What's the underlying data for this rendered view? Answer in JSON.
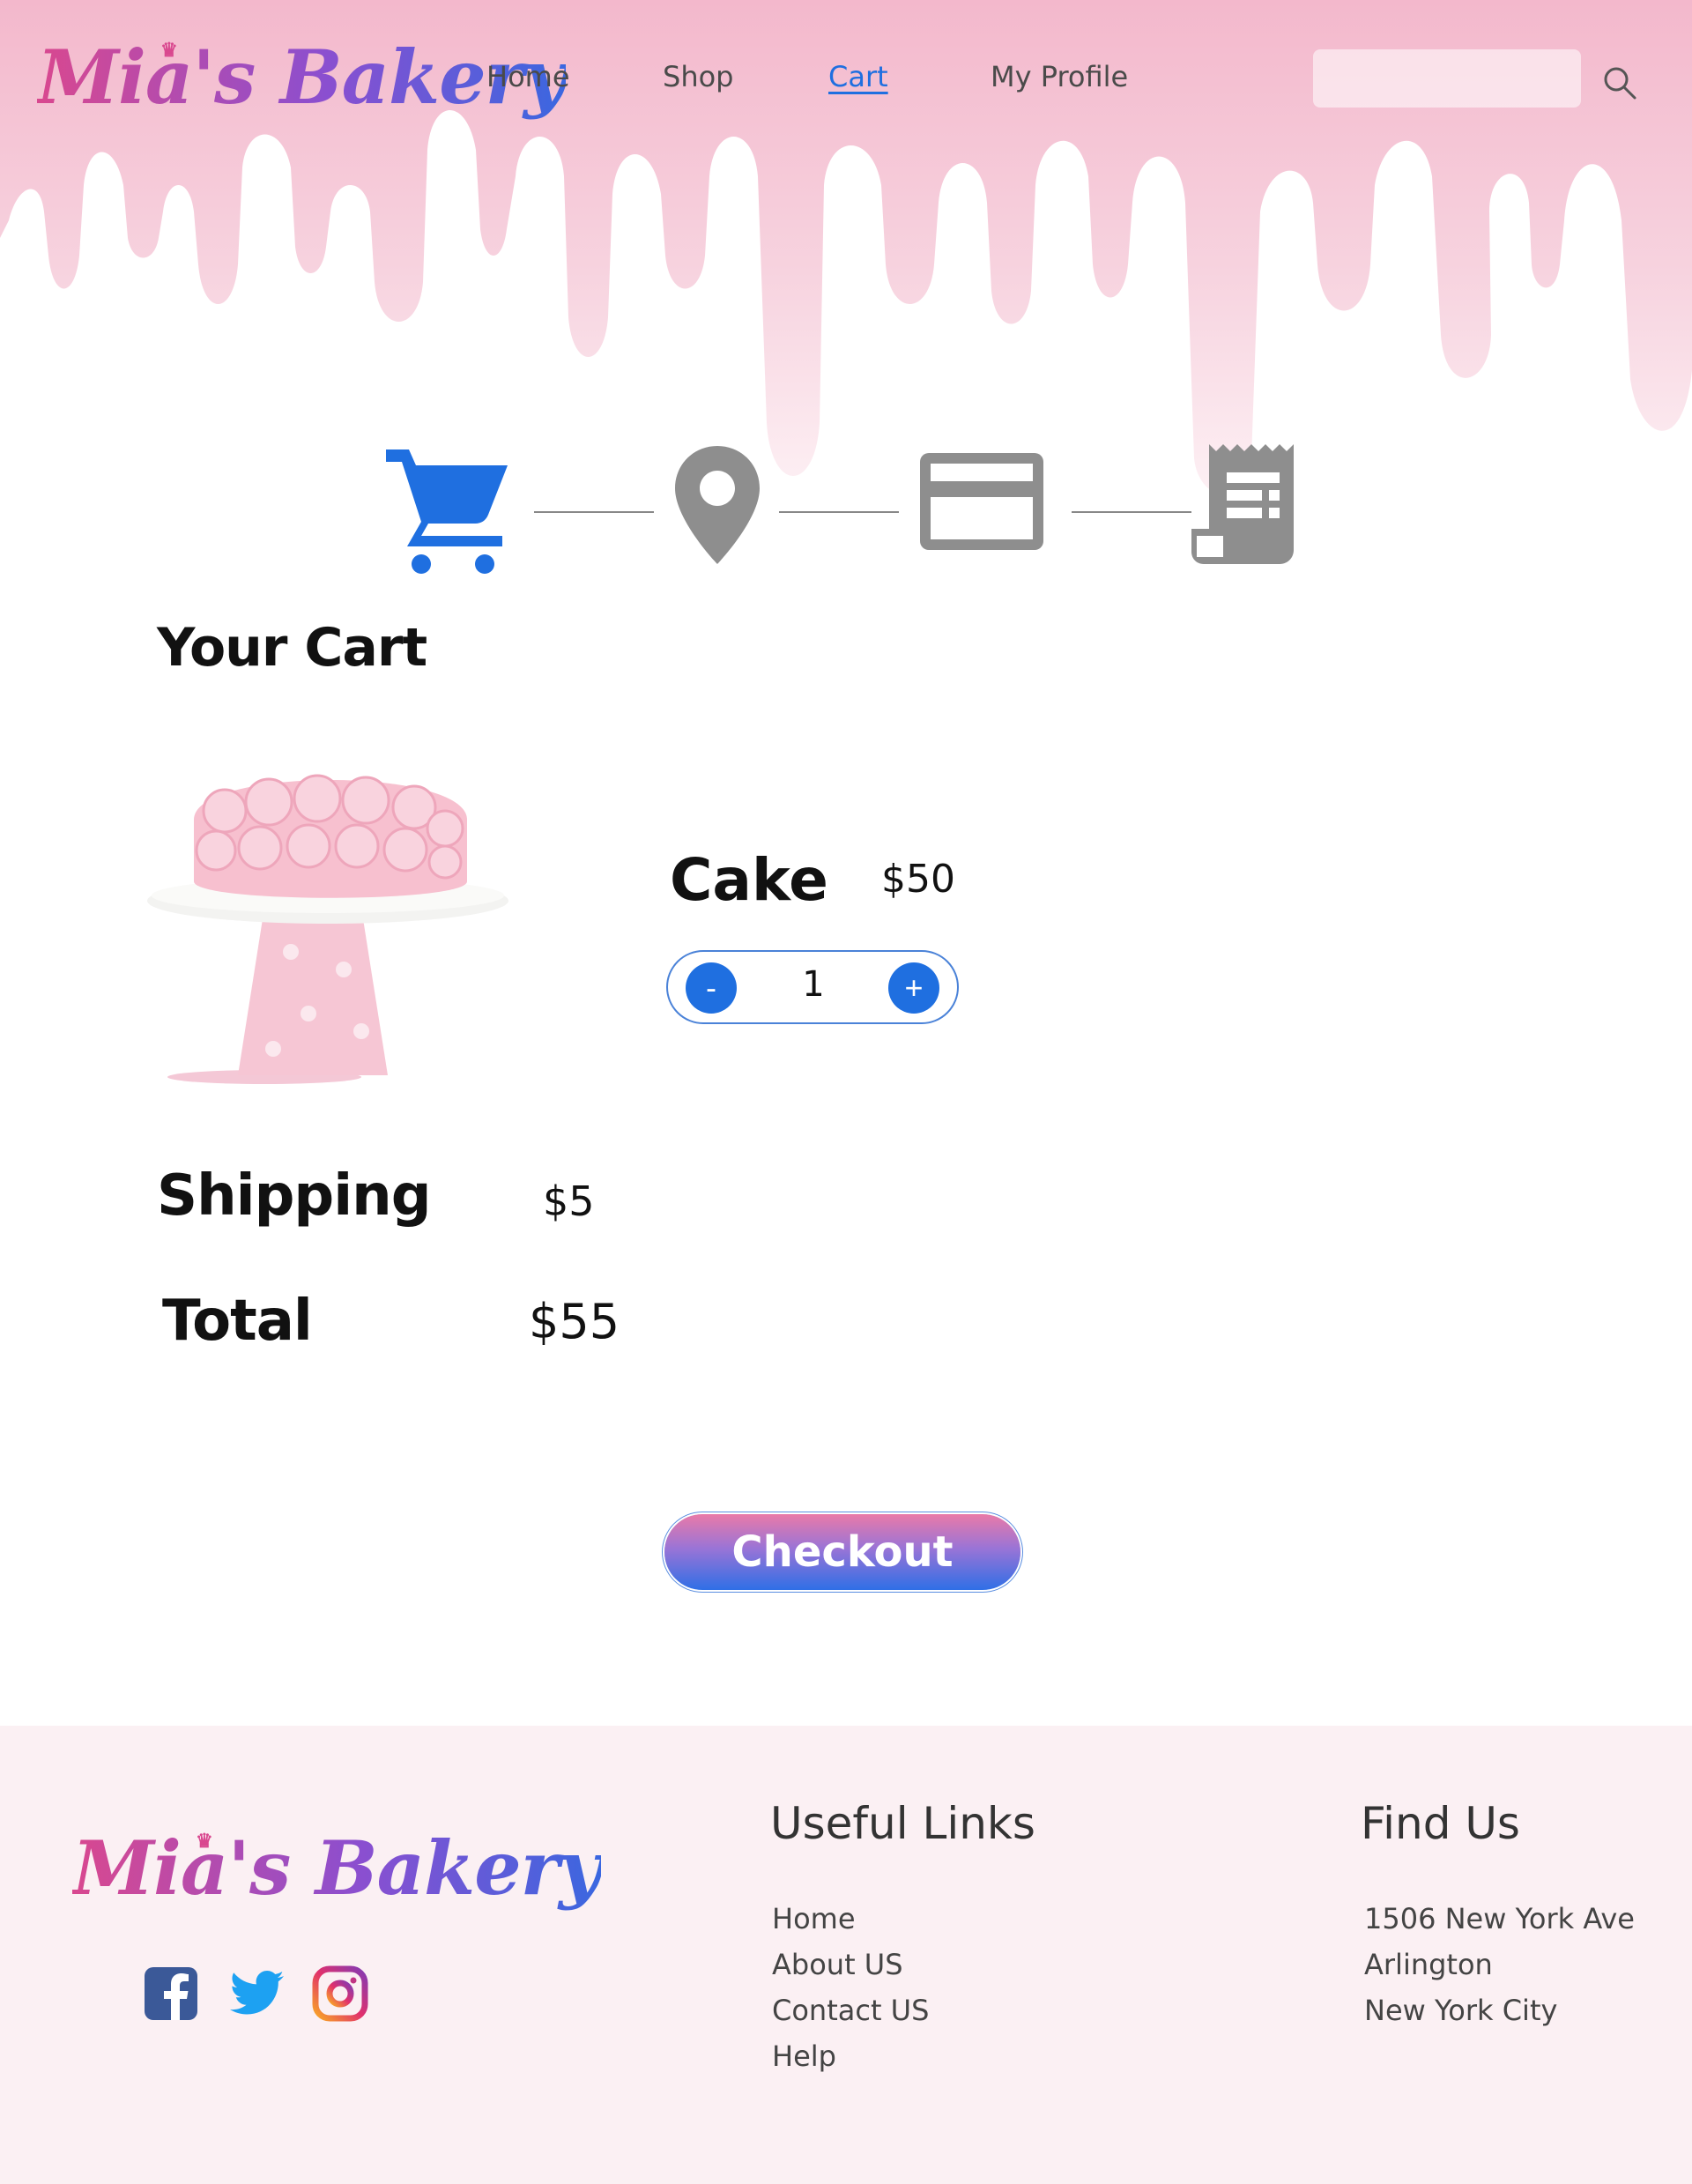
{
  "brand": {
    "name": "Mia's Bakery"
  },
  "nav": {
    "items": [
      {
        "label": "Home"
      },
      {
        "label": "Shop"
      },
      {
        "label": "Cart"
      },
      {
        "label": "My Profile"
      }
    ],
    "active": "Cart"
  },
  "search": {
    "placeholder": "",
    "icon": "search-icon"
  },
  "progress": {
    "steps": [
      {
        "icon": "shopping-cart-icon",
        "state": "active"
      },
      {
        "icon": "location-pin-icon",
        "state": "inactive"
      },
      {
        "icon": "credit-card-icon",
        "state": "inactive"
      },
      {
        "icon": "receipt-icon",
        "state": "inactive"
      }
    ],
    "active_color": "#1f6fe0",
    "inactive_color": "#8e8e8e"
  },
  "cart": {
    "title": "Your Cart",
    "item": {
      "name": "Cake",
      "price": "$50",
      "quantity": "1",
      "minus_label": "-",
      "plus_label": "+",
      "image": "pink-rose-cake-on-stand"
    },
    "shipping": {
      "label": "Shipping",
      "value": "$5"
    },
    "total": {
      "label": "Total",
      "value": "$55"
    },
    "checkout_label": "Checkout"
  },
  "footer": {
    "social": [
      "facebook-icon",
      "twitter-icon",
      "instagram-icon"
    ],
    "useful_links": {
      "heading": "Useful Links",
      "items": [
        "Home",
        "About US",
        "Contact US",
        "Help"
      ]
    },
    "find_us": {
      "heading": "Find Us",
      "lines": [
        "1506 New York Ave",
        "Arlington",
        "New York City"
      ]
    }
  },
  "colors": {
    "accent_blue": "#1f6fe0",
    "drip_pink": "#f4c0d2",
    "footer_bg": "#fbf0f3"
  }
}
